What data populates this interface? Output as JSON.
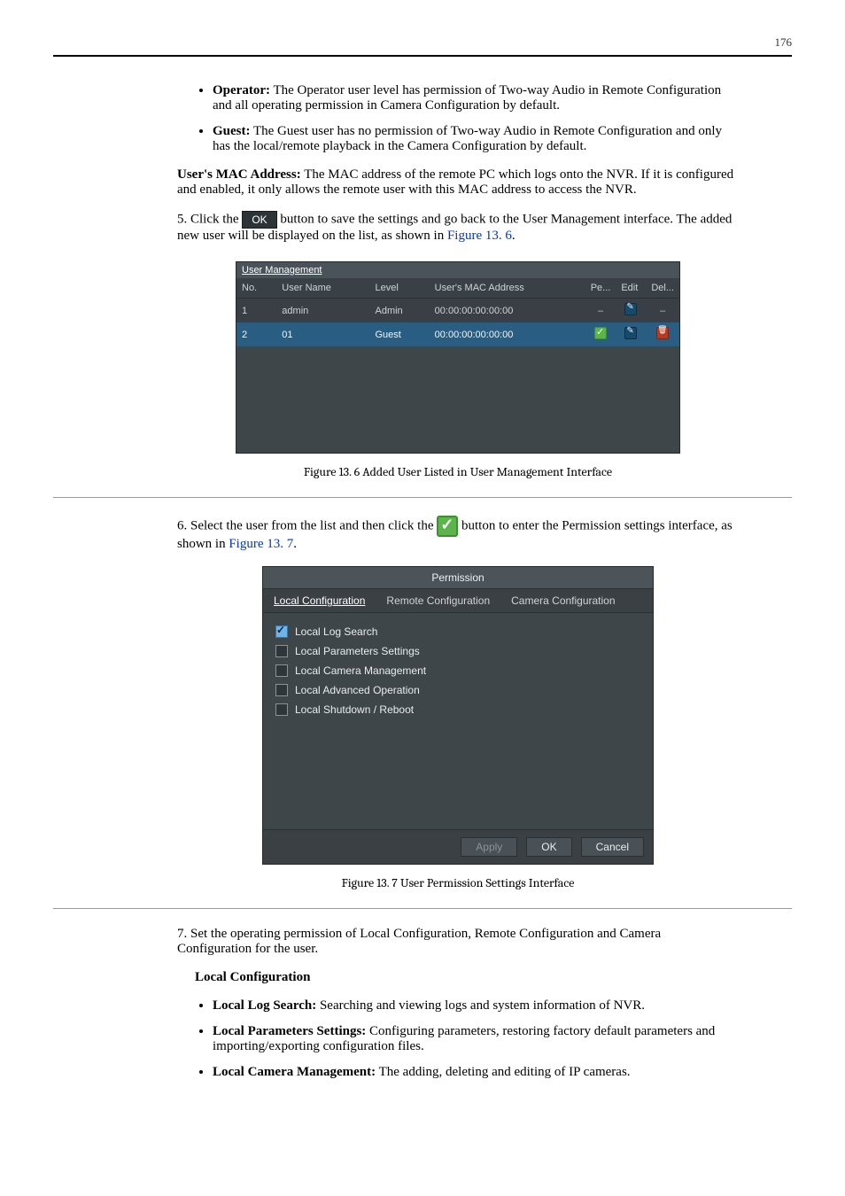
{
  "page_number": "176",
  "intro_bullets": [
    {
      "label": "Operator:",
      "text": " The Operator user level has permission of Two-way Audio in Remote Configuration and all operating permission in Camera Configuration by default."
    },
    {
      "label": "Guest:",
      "text": " The Guest user has no permission of Two-way Audio in Remote Configuration and only has the local/remote playback in the Camera Configuration by default."
    }
  ],
  "mac_label_bold": "User's MAC Address:",
  "mac_label_text": " The MAC address of the remote PC which logs onto the NVR. If it is configured and enabled, it only allows the remote user with this MAC address to access the NVR.",
  "step5_a": "Click the ",
  "ok_btn_label": "OK",
  "step5_b": " button to save the settings and go back to the User Management interface. The added new user will be displayed on the list, as shown in Figure 13. 6.",
  "fig6_ref": "Figure 13. 6",
  "um": {
    "title": "User Management",
    "cols": [
      "No.",
      "User Name",
      "Level",
      "User's MAC Address",
      "Pe...",
      "Edit",
      "Del..."
    ],
    "rows": [
      {
        "no": "1",
        "name": "admin",
        "level": "Admin",
        "mac": "00:00:00:00:00:00",
        "pe": "dash",
        "edit": true,
        "del": "dash"
      },
      {
        "no": "2",
        "name": "01",
        "level": "Guest",
        "mac": "00:00:00:00:00:00",
        "pe": "tick",
        "edit": true,
        "del": "del"
      }
    ]
  },
  "caption6": "Figure 13. 6 Added User Listed in User Management Interface",
  "step6_a": "Select the user from the list and then click the",
  "step6_b": "button to enter the Permission settings interface, as shown in Figure 13. 7.",
  "fig7_ref": "Figure 13. 7",
  "perm": {
    "title": "Permission",
    "tabs": [
      "Local Configuration",
      "Remote Configuration",
      "Camera Configuration"
    ],
    "items": [
      {
        "label": "Local Log Search",
        "checked": true
      },
      {
        "label": "Local Parameters Settings",
        "checked": false
      },
      {
        "label": "Local Camera Management",
        "checked": false
      },
      {
        "label": "Local Advanced Operation",
        "checked": false
      },
      {
        "label": "Local Shutdown / Reboot",
        "checked": false
      }
    ],
    "buttons": {
      "apply": "Apply",
      "ok": "OK",
      "cancel": "Cancel"
    }
  },
  "caption7": "Figure 13. 7 User Permission Settings Interface",
  "step7": "Set the operating permission of Local Configuration, Remote Configuration and Camera Configuration for the user.",
  "local_conf_heading": "Local Configuration",
  "local_conf_bullets": [
    {
      "label": "Local Log Search:",
      "text": " Searching and viewing logs and system information of NVR."
    },
    {
      "label": "Local Parameters Settings:",
      "text": " Configuring parameters, restoring factory default parameters and importing/exporting configuration files."
    },
    {
      "label": "Local Camera Management:",
      "text": " The adding, deleting and editing of IP cameras."
    }
  ]
}
